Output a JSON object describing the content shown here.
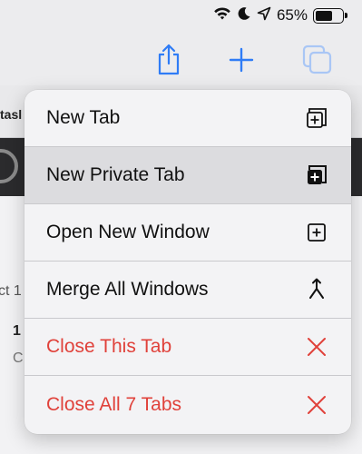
{
  "status_bar": {
    "battery_percent": "65%",
    "battery_level": 0.65,
    "icons": [
      "wifi-icon",
      "moon-icon",
      "location-arrow-icon",
      "battery-icon"
    ]
  },
  "toolbar": {
    "buttons": [
      {
        "name": "share",
        "icon": "share-icon"
      },
      {
        "name": "new-tab",
        "icon": "plus-icon"
      },
      {
        "name": "tab-overview",
        "icon": "tabs-icon"
      }
    ],
    "accent_color": "#2f7cf6"
  },
  "background_page": {
    "tab_fragment": "tasl",
    "text_fragment_1": "ct 1",
    "text_fragment_2": "1",
    "text_fragment_3": "C"
  },
  "menu": {
    "items": [
      {
        "label": "New Tab",
        "icon": "new-tab-icon",
        "style": "normal"
      },
      {
        "label": "New Private Tab",
        "icon": "private-tab-icon",
        "style": "normal",
        "highlighted": true
      },
      {
        "label": "Open New Window",
        "icon": "new-window-icon",
        "style": "normal"
      },
      {
        "label": "Merge All Windows",
        "icon": "merge-icon",
        "style": "normal"
      },
      {
        "label": "Close This Tab",
        "icon": "close-icon",
        "style": "destructive"
      },
      {
        "label": "Close All 7 Tabs",
        "icon": "close-icon",
        "style": "destructive"
      }
    ],
    "destructive_color": "#e0413a"
  }
}
